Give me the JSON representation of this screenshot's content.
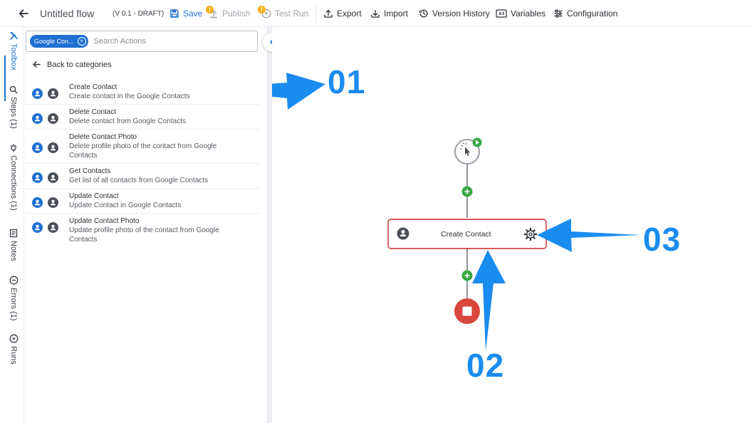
{
  "header": {
    "flow_title": "Untitled flow",
    "version": "(V 0.1 - DRAFT)",
    "save": "Save",
    "publish": "Publish",
    "publish_badge": "!",
    "test_run": "Test Run",
    "test_run_badge": "!",
    "export": "Export",
    "import": "Import",
    "version_history": "Version History",
    "variables": "Variables",
    "configuration": "Configuration"
  },
  "rail": {
    "toolbox": "Toolbox",
    "steps": "Steps (1)",
    "connections": "Connections (1)",
    "notes": "Notes",
    "errors": "Errors (1)",
    "runs": "Runs"
  },
  "search": {
    "chip": "Google Con...",
    "placeholder": "Search Actions"
  },
  "back": "Back to categories",
  "actions": [
    {
      "title": "Create Contact",
      "desc": "Create contact in the Google Contacts"
    },
    {
      "title": "Delete Contact",
      "desc": "Delete contact from Google Contacts"
    },
    {
      "title": "Delete Contact Photo",
      "desc": "Delete profile photo of the contact from Google Contacts"
    },
    {
      "title": "Get Contacts",
      "desc": "Get list of all contacts from Google Contacts"
    },
    {
      "title": "Update Contact",
      "desc": "Update Contact in Google Contacts"
    },
    {
      "title": "Update Contact Photo",
      "desc": "Update profile photo of the contact from Google Contacts"
    }
  ],
  "canvas": {
    "node_label": "Create Contact"
  },
  "annotations": {
    "a1": "01",
    "a2": "02",
    "a3": "03"
  },
  "colors": {
    "accent": "#1f6fd1",
    "annotation": "#1a8cf0",
    "add_button": "#3aa648",
    "stop": "#d9463b",
    "node_border": "#c9242b"
  }
}
